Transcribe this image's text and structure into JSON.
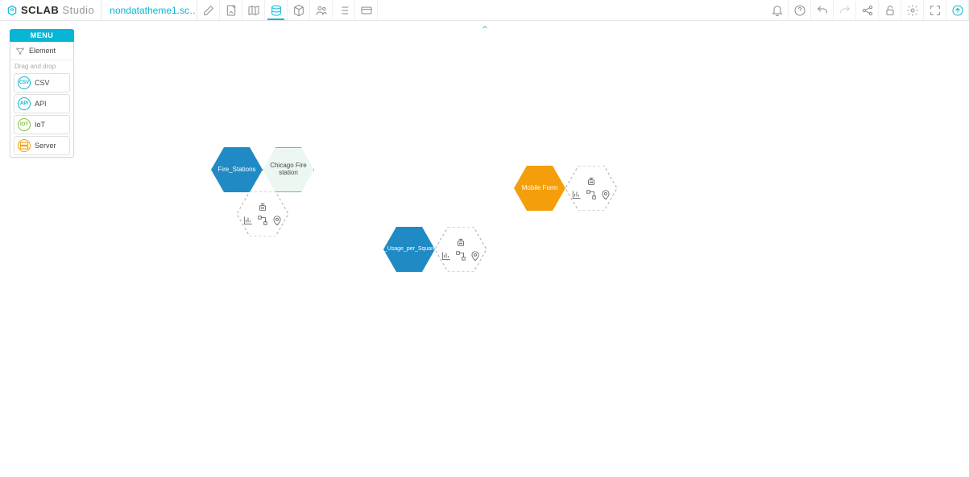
{
  "app": {
    "logo_sclab": "SCLAB",
    "logo_studio": "Studio"
  },
  "project": {
    "name": "nondatatheme1.sc…"
  },
  "toolbar_left": [
    {
      "name": "edit",
      "icon": "edit-icon"
    },
    {
      "name": "notes",
      "icon": "notes-icon"
    },
    {
      "name": "map",
      "icon": "map-icon"
    },
    {
      "name": "data",
      "icon": "data-icon",
      "active": true
    },
    {
      "name": "cube",
      "icon": "cube-icon"
    },
    {
      "name": "people",
      "icon": "people-icon"
    },
    {
      "name": "list",
      "icon": "list-icon"
    },
    {
      "name": "card",
      "icon": "card-icon"
    }
  ],
  "toolbar_right": [
    {
      "name": "bell",
      "icon": "bell-icon"
    },
    {
      "name": "help",
      "icon": "help-icon"
    },
    {
      "name": "undo",
      "icon": "undo-icon"
    },
    {
      "name": "redo",
      "icon": "redo-icon"
    },
    {
      "name": "share",
      "icon": "share-icon"
    },
    {
      "name": "unlock",
      "icon": "unlock-icon"
    },
    {
      "name": "settings",
      "icon": "settings-icon"
    },
    {
      "name": "expand",
      "icon": "expand-icon"
    },
    {
      "name": "export",
      "icon": "export-icon"
    }
  ],
  "sidepanel": {
    "header": "MENU",
    "items": [
      {
        "label": "Element"
      }
    ],
    "section_label": "Drag and drop",
    "drag": [
      {
        "kind": "csv",
        "badge": "CSV",
        "label": "CSV"
      },
      {
        "kind": "api",
        "badge": "API",
        "label": "API"
      },
      {
        "kind": "iot",
        "badge": "IOT",
        "label": "IoT"
      },
      {
        "kind": "server",
        "badge": "S",
        "label": "Server"
      }
    ]
  },
  "nodes": {
    "fire_stations": {
      "label": "Fire_Stations"
    },
    "chicago_fire": {
      "label": "Chicago Fire station"
    },
    "avg_elec": {
      "label": "Average_Electricity_Usage_per_Square_Foot_by_Commu"
    },
    "mobile_form": {
      "label": "Mobile Form"
    }
  }
}
